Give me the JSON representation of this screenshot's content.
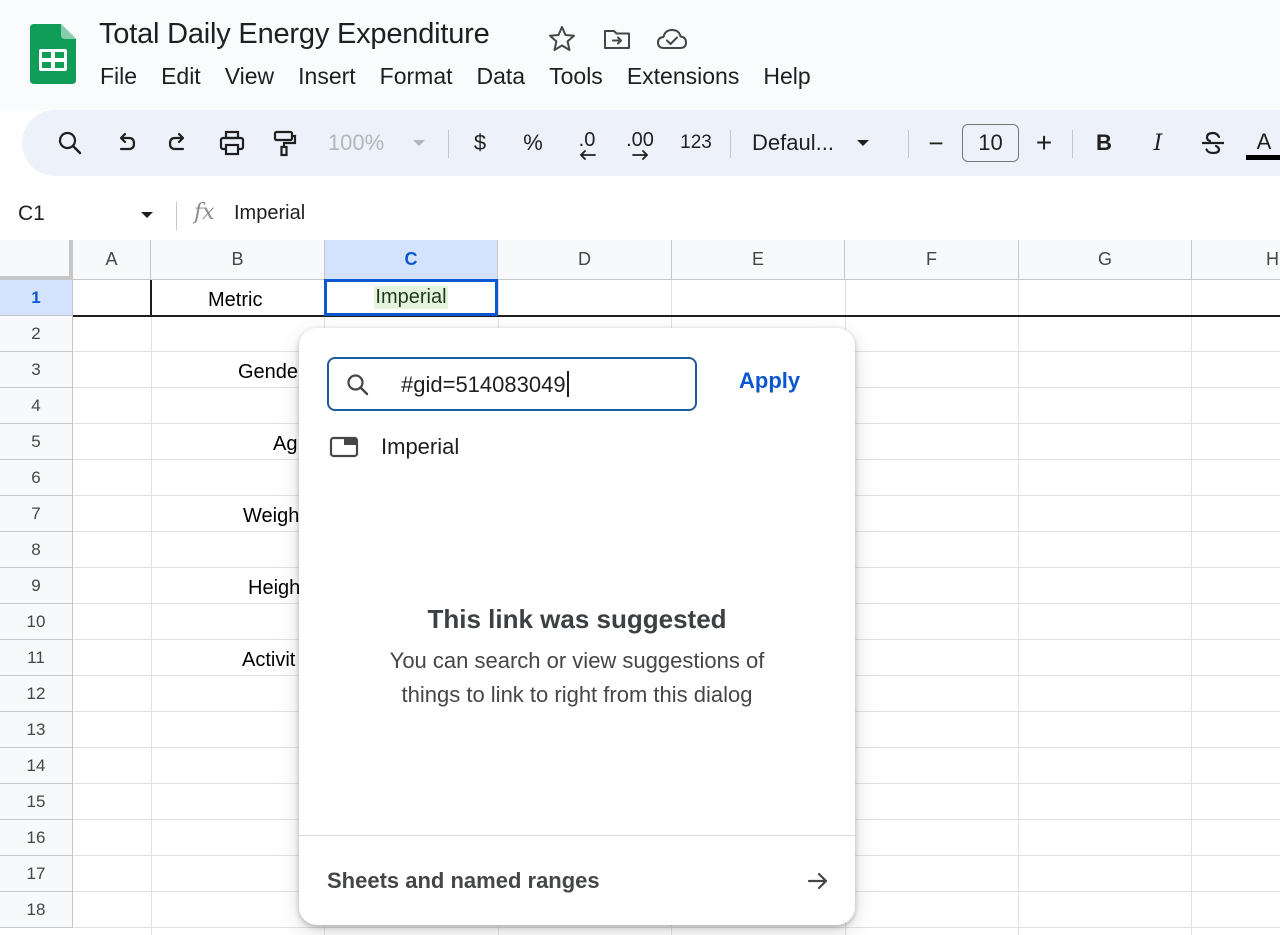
{
  "doc": {
    "title": "Total Daily Energy Expenditure"
  },
  "menu": [
    "File",
    "Edit",
    "View",
    "Insert",
    "Format",
    "Data",
    "Tools",
    "Extensions",
    "Help"
  ],
  "toolbar": {
    "zoom": "100%",
    "currency": "$",
    "percent": "%",
    "decrease_decimals": ".0",
    "increase_decimals": ".00",
    "number_format": "123",
    "font": "Defaul...",
    "minus": "−",
    "font_size": "10",
    "plus": "+",
    "bold": "B",
    "italic": "I",
    "text_color": "A"
  },
  "formula_bar": {
    "name_box": "C1",
    "fx": "fx",
    "value": "Imperial"
  },
  "columns": [
    "A",
    "B",
    "C",
    "D",
    "E",
    "F",
    "G",
    "H"
  ],
  "rows": [
    "1",
    "2",
    "3",
    "4",
    "5",
    "6",
    "7",
    "8",
    "9",
    "10",
    "11",
    "12",
    "13",
    "14",
    "15",
    "16",
    "17",
    "18"
  ],
  "cells": {
    "b1": "Metric",
    "c1": "Imperial",
    "b3": "Gende",
    "b5": "Ag",
    "b7": "Weigh",
    "b9": "Heigh",
    "b11": "Activit"
  },
  "dialog": {
    "input_value": "#gid=514083049",
    "apply": "Apply",
    "suggestion": "Imperial",
    "empty_title": "This link was suggested",
    "empty_text": "You can search or view suggestions of things to link to right from this dialog",
    "footer": "Sheets and named ranges"
  },
  "colors": {
    "accent": "#0b57d0",
    "sheets_green": "#0f9d58",
    "selection": "#d3e3fd",
    "toolbar_bg": "#edf2fa"
  }
}
